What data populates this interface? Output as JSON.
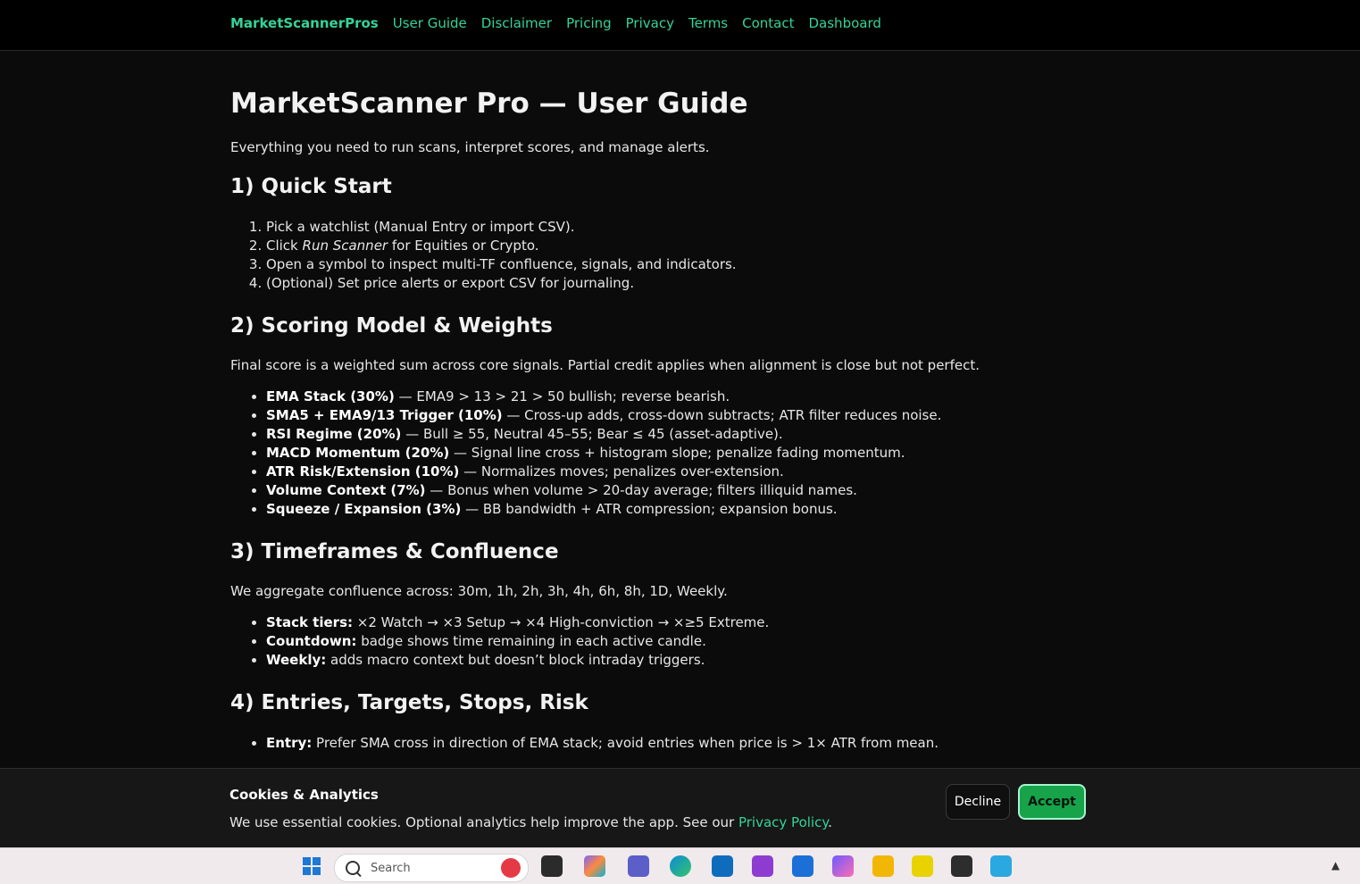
{
  "nav": {
    "brand": "MarketScannerPros",
    "links": [
      "User Guide",
      "Disclaimer",
      "Pricing",
      "Privacy",
      "Terms",
      "Contact",
      "Dashboard"
    ]
  },
  "page": {
    "title": "MarketScanner Pro — User Guide",
    "lead": "Everything you need to run scans, interpret scores, and manage alerts."
  },
  "sections": {
    "s1": {
      "heading": "1) Quick Start",
      "items": [
        {
          "pre": "Pick a watchlist (Manual Entry or import CSV).",
          "em": "",
          "post": ""
        },
        {
          "pre": "Click ",
          "em": "Run Scanner",
          "post": " for Equities or Crypto."
        },
        {
          "pre": "Open a symbol to inspect multi-TF confluence, signals, and indicators.",
          "em": "",
          "post": ""
        },
        {
          "pre": "(Optional) Set price alerts or export CSV for journaling.",
          "em": "",
          "post": ""
        }
      ]
    },
    "s2": {
      "heading": "2) Scoring Model & Weights",
      "para": "Final score is a weighted sum across core signals. Partial credit applies when alignment is close but not perfect.",
      "items": [
        {
          "b": "EMA Stack (30%)",
          "t": " — EMA9 > 13 > 21 > 50 bullish; reverse bearish."
        },
        {
          "b": "SMA5 + EMA9/13 Trigger (10%)",
          "t": " — Cross-up adds, cross-down subtracts; ATR filter reduces noise."
        },
        {
          "b": "RSI Regime (20%)",
          "t": " — Bull ≥ 55, Neutral 45–55; Bear ≤ 45 (asset-adaptive)."
        },
        {
          "b": "MACD Momentum (20%)",
          "t": " — Signal line cross + histogram slope; penalize fading momentum."
        },
        {
          "b": "ATR Risk/Extension (10%)",
          "t": " — Normalizes moves; penalizes over-extension."
        },
        {
          "b": "Volume Context (7%)",
          "t": " — Bonus when volume > 20-day average; filters illiquid names."
        },
        {
          "b": "Squeeze / Expansion (3%)",
          "t": " — BB bandwidth + ATR compression; expansion bonus."
        }
      ]
    },
    "s3": {
      "heading": "3) Timeframes & Confluence",
      "para": "We aggregate confluence across: 30m, 1h, 2h, 3h, 4h, 6h, 8h, 1D, Weekly.",
      "items": [
        {
          "b": "Stack tiers:",
          "t": " ×2 Watch → ×3 Setup → ×4 High-conviction → ×≥5 Extreme."
        },
        {
          "b": "Countdown:",
          "t": " badge shows time remaining in each active candle."
        },
        {
          "b": "Weekly:",
          "t": " adds macro context but doesn’t block intraday triggers."
        }
      ]
    },
    "s4": {
      "heading": "4) Entries, Targets, Stops, Risk",
      "items": [
        {
          "b": "Entry:",
          "t": " Prefer SMA cross in direction of EMA stack; avoid entries when price is > 1× ATR from mean."
        }
      ]
    }
  },
  "cookie": {
    "title": "Cookies & Analytics",
    "text": "We use essential cookies. Optional analytics help improve the app. See our ",
    "link": "Privacy Policy",
    "after": ".",
    "decline": "Decline",
    "accept": "Accept"
  },
  "taskbar": {
    "search_placeholder": "Search",
    "icons": [
      "windows-start-icon",
      "task-view-icon",
      "copilot-icon",
      "teams-icon",
      "edge-icon",
      "outlook-icon",
      "visual-studio-icon",
      "store-icon",
      "m365-icon",
      "file-explorer-icon",
      "app-icon",
      "terminal-icon",
      "notepad-icon"
    ],
    "accent": "#16a34a",
    "link_color": "#34d399"
  }
}
